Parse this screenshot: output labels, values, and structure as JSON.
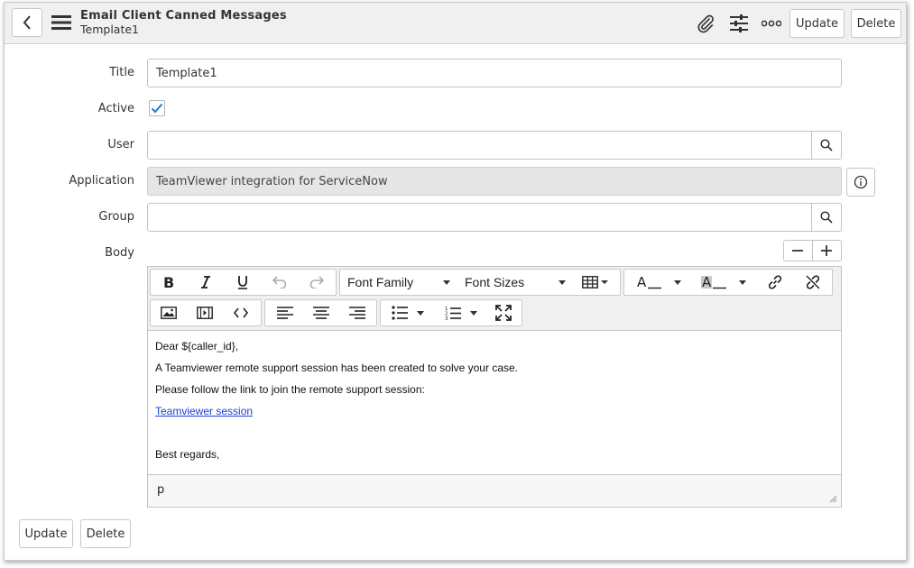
{
  "header": {
    "form_name": "Email Client Canned Messages",
    "record_name": "Template1",
    "update_label": "Update",
    "delete_label": "Delete",
    "icons": [
      "back-icon",
      "menu-icon",
      "paperclip-icon",
      "settings-sliders-icon",
      "more-icon"
    ]
  },
  "form": {
    "title_label": "Title",
    "title_value": "Template1",
    "active_label": "Active",
    "active_checked": true,
    "user_label": "User",
    "user_value": "",
    "application_label": "Application",
    "application_value": "TeamViewer integration for ServiceNow",
    "group_label": "Group",
    "group_value": "",
    "body_label": "Body"
  },
  "editor": {
    "font_family_label": "Font Family",
    "font_sizes_label": "Font Sizes",
    "text_color_glyph": "A",
    "bg_color_glyph": "A",
    "body_lines": [
      "Dear ${caller_id},",
      "A Teamviewer remote support session has been created to solve your case.",
      "Please follow the link to join the remote support session:",
      "Teamviewer session",
      "",
      "Best regards,"
    ],
    "status_path": "p"
  },
  "footer": {
    "update_label": "Update",
    "delete_label": "Delete"
  },
  "colors": {
    "header_bg": "#f0f0f0",
    "check_color": "#1f7bd8",
    "link_color": "#1a3fd6",
    "readonly_bg": "#e6e6e6"
  }
}
